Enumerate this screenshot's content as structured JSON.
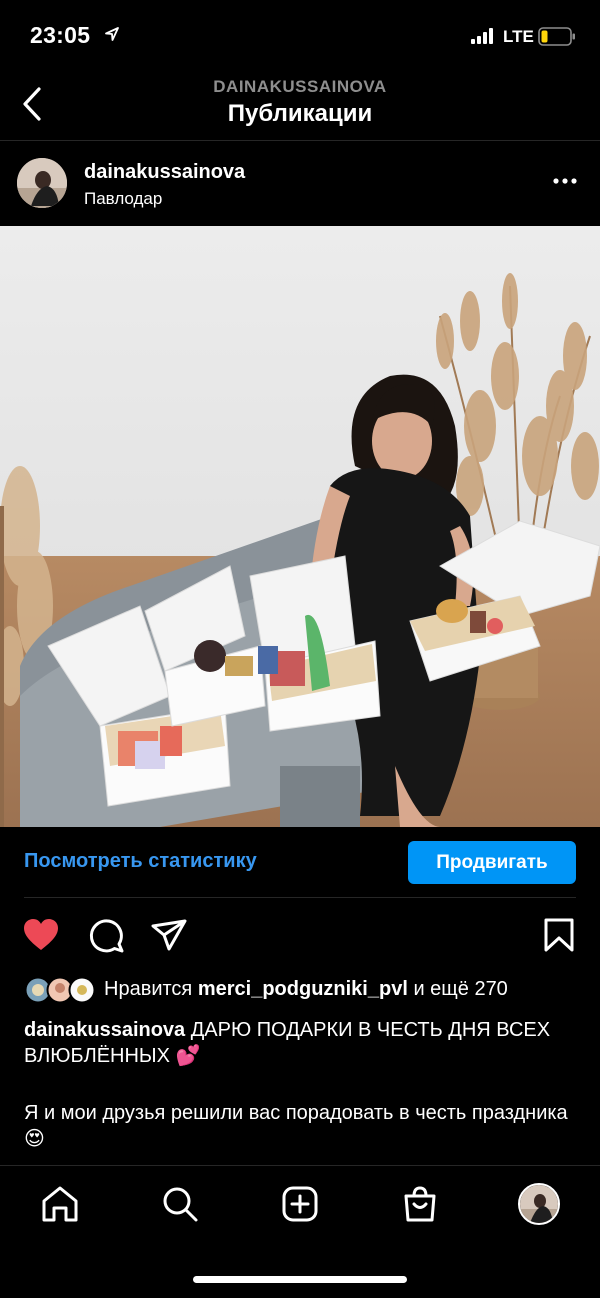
{
  "status_bar": {
    "time": "23:05",
    "network": "LTE"
  },
  "header": {
    "account": "DAINAKUSSAINOVA",
    "title": "Публикации"
  },
  "post": {
    "author": "dainakussainova",
    "location": "Павлодар",
    "stats_link": "Посмотреть статистику",
    "promote_button": "Продвигать",
    "liked": true,
    "likes": {
      "prefix": "Нравится",
      "user": "merci_podguzniki_pvl",
      "and_more": "и ещё 270"
    },
    "caption_author": "dainakussainova",
    "caption_text": "ДАРЮ ПОДАРКИ В ЧЕСТЬ ДНЯ ВСЕХ ВЛЮБЛЁННЫХ 💕",
    "caption_line2": "Я и мои друзья решили вас порадовать в честь праздника 😍"
  },
  "colors": {
    "accent": "#0095f6",
    "link": "#3897f0",
    "like": "#ed4956"
  },
  "icons": [
    "location-arrow-icon",
    "signal-icon",
    "battery-icon",
    "back-chevron-icon",
    "more-icon",
    "heart-icon",
    "comment-icon",
    "share-icon",
    "bookmark-icon",
    "home-icon",
    "search-icon",
    "create-icon",
    "shop-icon"
  ]
}
